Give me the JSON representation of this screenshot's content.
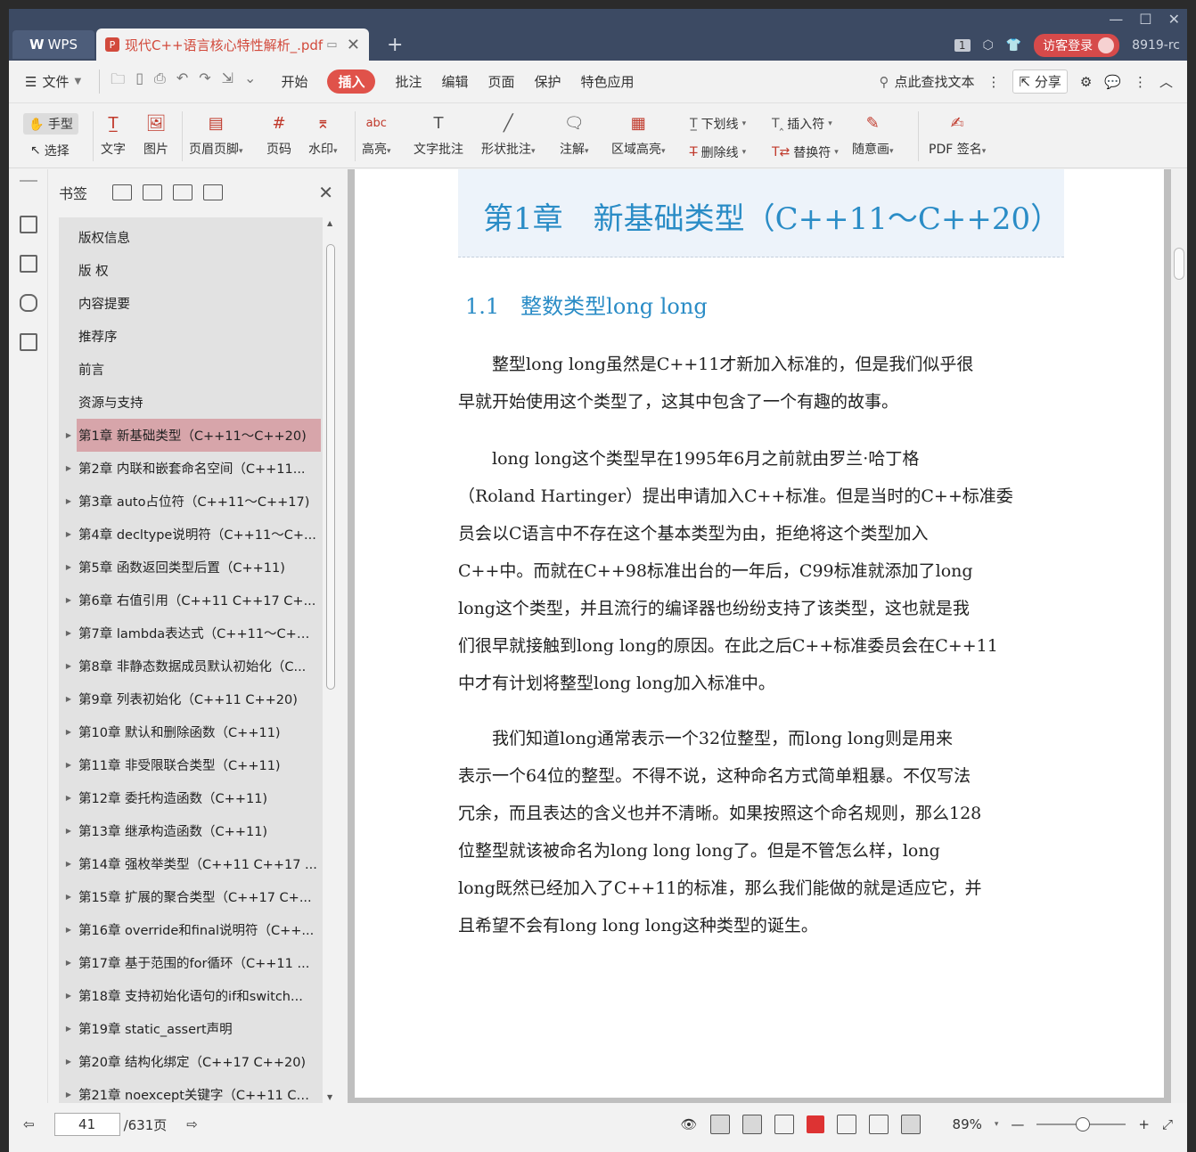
{
  "titlebar": {
    "wps_tab": "WPS",
    "doc_tab": "现代C++语言核心特性解析_.pdf",
    "page_badge": "1",
    "guest_login": "访客登录",
    "user_code": "8919-rc"
  },
  "menubar": {
    "file": "文件",
    "tabs": [
      "开始",
      "插入",
      "批注",
      "编辑",
      "页面",
      "保护",
      "特色应用"
    ],
    "active_tab": "插入",
    "search": "点此查找文本",
    "share": "分享"
  },
  "ribbon": {
    "hand": "手型",
    "select": "选择",
    "text": "文字",
    "image": "图片",
    "header_footer": "页眉页脚",
    "page_number": "页码",
    "watermark": "水印",
    "highlight": "高亮",
    "text_annotation": "文字批注",
    "shape_annotation": "形状批注",
    "note": "注解",
    "area_highlight": "区域高亮",
    "underline": "下划线",
    "strikethrough": "删除线",
    "insert_mark": "插入符",
    "replace_mark": "替换符",
    "freehand": "随意画",
    "pdf_sign": "PDF 签名"
  },
  "bookmarks": {
    "title": "书签",
    "items": [
      {
        "label": "版权信息",
        "expandable": false,
        "selected": false
      },
      {
        "label": "版 权",
        "expandable": false,
        "selected": false
      },
      {
        "label": "内容提要",
        "expandable": false,
        "selected": false
      },
      {
        "label": "推荐序",
        "expandable": false,
        "selected": false
      },
      {
        "label": "前言",
        "expandable": false,
        "selected": false
      },
      {
        "label": "资源与支持",
        "expandable": false,
        "selected": false
      },
      {
        "label": "第1章 新基础类型（C++11～C++20)",
        "expandable": true,
        "selected": true
      },
      {
        "label": "第2章 内联和嵌套命名空间（C++11...",
        "expandable": true,
        "selected": false
      },
      {
        "label": "第3章 auto占位符（C++11～C++17)",
        "expandable": true,
        "selected": false
      },
      {
        "label": "第4章 decltype说明符（C++11～C+...",
        "expandable": true,
        "selected": false
      },
      {
        "label": "第5章 函数返回类型后置（C++11)",
        "expandable": true,
        "selected": false
      },
      {
        "label": "第6章 右值引用（C++11 C++17 C+...",
        "expandable": true,
        "selected": false
      },
      {
        "label": "第7章 lambda表达式（C++11～C++...",
        "expandable": true,
        "selected": false
      },
      {
        "label": "第8章 非静态数据成员默认初始化（C...",
        "expandable": true,
        "selected": false
      },
      {
        "label": "第9章 列表初始化（C++11 C++20)",
        "expandable": true,
        "selected": false
      },
      {
        "label": "第10章 默认和删除函数（C++11)",
        "expandable": true,
        "selected": false
      },
      {
        "label": "第11章 非受限联合类型（C++11)",
        "expandable": true,
        "selected": false
      },
      {
        "label": "第12章 委托构造函数（C++11)",
        "expandable": true,
        "selected": false
      },
      {
        "label": "第13章 继承构造函数（C++11)",
        "expandable": true,
        "selected": false
      },
      {
        "label": "第14章 强枚举类型（C++11 C++17 ...",
        "expandable": true,
        "selected": false
      },
      {
        "label": "第15章 扩展的聚合类型（C++17 C+...",
        "expandable": true,
        "selected": false
      },
      {
        "label": "第16章 override和final说明符（C++...",
        "expandable": true,
        "selected": false
      },
      {
        "label": "第17章 基于范围的for循环（C++11 ...",
        "expandable": true,
        "selected": false
      },
      {
        "label": "第18章 支持初始化语句的if和switch...",
        "expandable": true,
        "selected": false
      },
      {
        "label": "第19章 static_assert声明",
        "expandable": true,
        "selected": false
      },
      {
        "label": "第20章 结构化绑定（C++17 C++20)",
        "expandable": true,
        "selected": false
      },
      {
        "label": "第21章 noexcept关键字（C++11 C+...",
        "expandable": true,
        "selected": false
      }
    ]
  },
  "document": {
    "chapter": "第1章　新基础类型（C++11～C++20）",
    "section": "1.1　整数类型long long",
    "para1": [
      "整型long long虽然是C++11才新加入标准的，但是我们似乎很",
      "早就开始使用这个类型了，这其中包含了一个有趣的故事。"
    ],
    "para2": [
      "long long这个类型早在1995年6月之前就由罗兰·哈丁格",
      "（Roland Hartinger）提出申请加入C++标准。但是当时的C++标准委",
      "员会以C语言中不存在这个基本类型为由，拒绝将这个类型加入",
      "C++中。而就在C++98标准出台的一年后，C99标准就添加了long",
      "long这个类型，并且流行的编译器也纷纷支持了该类型，这也就是我",
      "们很早就接触到long long的原因。在此之后C++标准委员会在C++11",
      "中才有计划将整型long long加入标准中。"
    ],
    "para3": [
      "我们知道long通常表示一个32位整型，而long long则是用来",
      "表示一个64位的整型。不得不说，这种命名方式简单粗暴。不仅写法",
      "冗余，而且表达的含义也并不清晰。如果按照这个命名规则，那么128",
      "位整型就该被命名为long long long了。但是不管怎么样，long",
      "long既然已经加入了C++11的标准，那么我们能做的就是适应它，并",
      "且希望不会有long long long这种类型的诞生。"
    ]
  },
  "statusbar": {
    "current_page": "41",
    "total_pages": "/631页",
    "zoom": "89%"
  }
}
